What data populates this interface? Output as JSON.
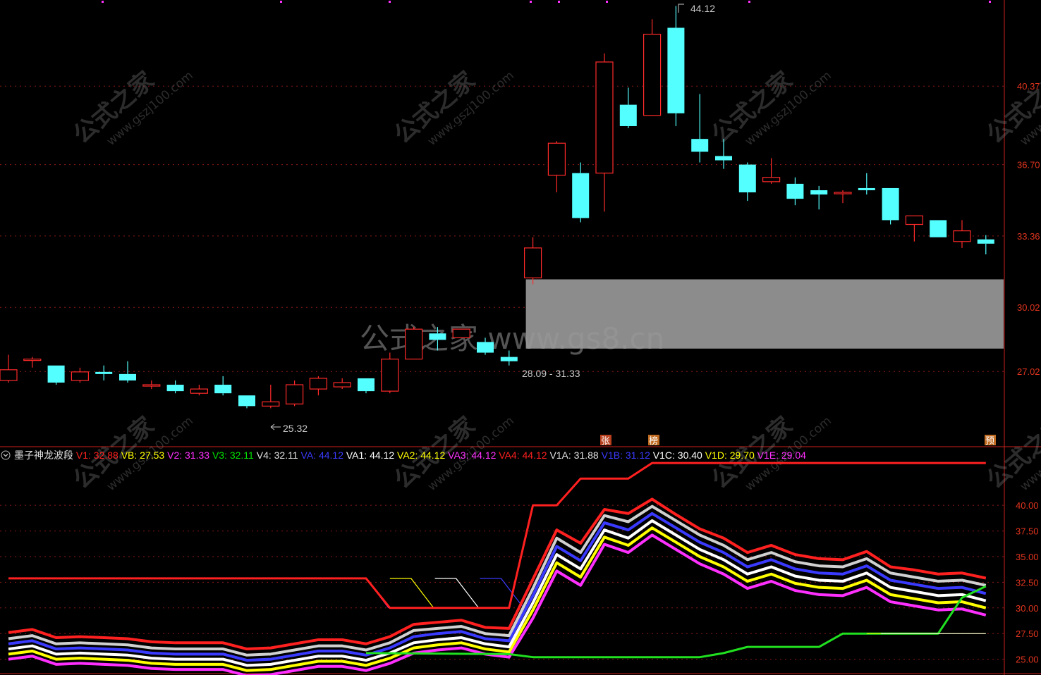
{
  "indicator": {
    "name": "墨子神龙波段",
    "collapse_icon": "chevron-down-circle-icon",
    "params": [
      {
        "key": "V1",
        "label": "V1:",
        "value": "32.88",
        "color": "#ff2020"
      },
      {
        "key": "VB",
        "label": "VB:",
        "value": "27.53",
        "color": "#ffff00"
      },
      {
        "key": "V2",
        "label": "V2:",
        "value": "31.33",
        "color": "#ff30ff"
      },
      {
        "key": "V3",
        "label": "V3:",
        "value": "32.11",
        "color": "#00e000"
      },
      {
        "key": "V4",
        "label": "V4:",
        "value": "32.11",
        "color": "#e0e0e0"
      },
      {
        "key": "VA",
        "label": "VA:",
        "value": "44.12",
        "color": "#3a3aff"
      },
      {
        "key": "VA1",
        "label": "VA1:",
        "value": "44.12",
        "color": "#ffffff"
      },
      {
        "key": "VA2",
        "label": "VA2:",
        "value": "44.12",
        "color": "#ffff00"
      },
      {
        "key": "VA3",
        "label": "VA3:",
        "value": "44.12",
        "color": "#ff30ff"
      },
      {
        "key": "VA4",
        "label": "VA4:",
        "value": "44.12",
        "color": "#ff2020"
      },
      {
        "key": "V1A",
        "label": "V1A:",
        "value": "31.88",
        "color": "#e0e0e0"
      },
      {
        "key": "V1B",
        "label": "V1B:",
        "value": "31.12",
        "color": "#3a3aff"
      },
      {
        "key": "V1C",
        "label": "V1C:",
        "value": "30.40",
        "color": "#ffffff"
      },
      {
        "key": "V1D",
        "label": "V1D:",
        "value": "29.70",
        "color": "#ffff00"
      },
      {
        "key": "V1E",
        "label": "V1E:",
        "value": "29.04",
        "color": "#ff30ff"
      }
    ]
  },
  "watermark": {
    "center": "公式之家 www.gs8.cn",
    "tile_cn": "公式之家",
    "tile_url": "www.gszj100.com"
  },
  "annotations": {
    "high_label": "44.12",
    "low_label": "25.32",
    "zone_label": "28.09 - 31.33"
  },
  "tags": [
    {
      "text": "张",
      "color": "#b8401e"
    },
    {
      "text": "榜",
      "color": "#c06a20"
    },
    {
      "text": "预",
      "color": "#c06a20"
    }
  ],
  "chart_data": [
    {
      "type": "candlestick",
      "y_axis_ticks": [
        "40.37",
        "36.70",
        "33.36",
        "30.02",
        "27.02"
      ],
      "y_tick_values": [
        40.37,
        36.7,
        33.36,
        30.02,
        27.02
      ],
      "ylim": [
        23.5,
        44.4
      ],
      "colors": {
        "up": "#ff2a2a",
        "down": "#54ffff"
      },
      "candles": [
        {
          "o": 26.6,
          "h": 27.8,
          "l": 26.5,
          "c": 27.1
        },
        {
          "o": 27.6,
          "h": 27.7,
          "l": 27.2,
          "c": 27.6
        },
        {
          "o": 27.3,
          "h": 27.3,
          "l": 26.4,
          "c": 26.5
        },
        {
          "o": 26.6,
          "h": 27.2,
          "l": 26.5,
          "c": 27.0
        },
        {
          "o": 27.0,
          "h": 27.3,
          "l": 26.6,
          "c": 26.9
        },
        {
          "o": 26.9,
          "h": 27.5,
          "l": 26.5,
          "c": 26.6
        },
        {
          "o": 26.4,
          "h": 26.6,
          "l": 26.2,
          "c": 26.4
        },
        {
          "o": 26.4,
          "h": 26.6,
          "l": 26.0,
          "c": 26.1
        },
        {
          "o": 26.0,
          "h": 26.4,
          "l": 25.9,
          "c": 26.2
        },
        {
          "o": 26.4,
          "h": 26.8,
          "l": 25.9,
          "c": 26.0
        },
        {
          "o": 25.9,
          "h": 25.9,
          "l": 25.3,
          "c": 25.4
        },
        {
          "o": 25.4,
          "h": 26.4,
          "l": 25.3,
          "c": 25.6
        },
        {
          "o": 25.5,
          "h": 26.6,
          "l": 25.4,
          "c": 26.4
        },
        {
          "o": 26.2,
          "h": 26.8,
          "l": 25.9,
          "c": 26.7
        },
        {
          "o": 26.3,
          "h": 26.7,
          "l": 26.2,
          "c": 26.5
        },
        {
          "o": 26.7,
          "h": 26.7,
          "l": 26.0,
          "c": 26.1
        },
        {
          "o": 26.1,
          "h": 27.9,
          "l": 26.0,
          "c": 27.6
        },
        {
          "o": 27.6,
          "h": 29.1,
          "l": 27.6,
          "c": 29.0
        },
        {
          "o": 28.8,
          "h": 29.1,
          "l": 28.0,
          "c": 28.5
        },
        {
          "o": 28.6,
          "h": 29.0,
          "l": 28.6,
          "c": 29.0
        },
        {
          "o": 28.4,
          "h": 28.6,
          "l": 27.8,
          "c": 27.9
        },
        {
          "o": 27.7,
          "h": 28.0,
          "l": 27.3,
          "c": 27.5
        },
        {
          "o": 31.4,
          "h": 33.3,
          "l": 31.1,
          "c": 32.8
        },
        {
          "o": 36.2,
          "h": 37.8,
          "l": 35.4,
          "c": 37.7
        },
        {
          "o": 36.3,
          "h": 36.8,
          "l": 34.0,
          "c": 34.2
        },
        {
          "o": 36.3,
          "h": 41.9,
          "l": 34.5,
          "c": 41.5
        },
        {
          "o": 39.5,
          "h": 40.3,
          "l": 38.4,
          "c": 38.5
        },
        {
          "o": 39.0,
          "h": 43.5,
          "l": 39.0,
          "c": 42.8
        },
        {
          "o": 43.1,
          "h": 44.12,
          "l": 38.5,
          "c": 39.1
        },
        {
          "o": 37.9,
          "h": 40.0,
          "l": 36.8,
          "c": 37.3
        },
        {
          "o": 37.1,
          "h": 37.9,
          "l": 36.5,
          "c": 36.9
        },
        {
          "o": 36.7,
          "h": 36.8,
          "l": 35.0,
          "c": 35.4
        },
        {
          "o": 35.9,
          "h": 37.0,
          "l": 35.8,
          "c": 36.1
        },
        {
          "o": 35.8,
          "h": 36.1,
          "l": 34.8,
          "c": 35.1
        },
        {
          "o": 35.5,
          "h": 35.7,
          "l": 34.6,
          "c": 35.3
        },
        {
          "o": 35.4,
          "h": 35.5,
          "l": 34.9,
          "c": 35.4
        },
        {
          "o": 35.6,
          "h": 36.3,
          "l": 35.3,
          "c": 35.5
        },
        {
          "o": 35.6,
          "h": 35.6,
          "l": 33.9,
          "c": 34.1
        },
        {
          "o": 33.9,
          "h": 34.3,
          "l": 33.1,
          "c": 34.3
        },
        {
          "o": 34.1,
          "h": 34.1,
          "l": 33.3,
          "c": 33.3
        },
        {
          "o": 33.1,
          "h": 34.1,
          "l": 32.8,
          "c": 33.6
        },
        {
          "o": 33.2,
          "h": 33.4,
          "l": 32.5,
          "c": 33.0
        }
      ],
      "zone": {
        "low": 28.09,
        "high": 31.33,
        "from_index": 22,
        "color": "#8c8c8c"
      }
    },
    {
      "type": "line",
      "y_axis_ticks": [
        "40.00",
        "37.50",
        "35.00",
        "32.50",
        "30.00",
        "27.50",
        "25.00"
      ],
      "y_tick_values": [
        40.0,
        37.5,
        35.0,
        32.5,
        30.0,
        27.5,
        25.0
      ],
      "ylim": [
        23.6,
        44.2
      ],
      "series": [
        {
          "name": "V1",
          "color": "#ff2020",
          "width": 4,
          "values": [
            27.6,
            27.9,
            27.1,
            27.2,
            27.1,
            27.0,
            26.7,
            26.6,
            26.6,
            26.6,
            26.0,
            26.1,
            26.5,
            26.9,
            26.9,
            26.5,
            27.2,
            28.4,
            28.6,
            28.8,
            28.1,
            28.0,
            32.8,
            37.6,
            36.3,
            39.6,
            39.2,
            40.6,
            39.1,
            37.7,
            36.8,
            35.4,
            36.1,
            35.2,
            34.8,
            34.7,
            35.5,
            34.0,
            33.7,
            33.3,
            33.4,
            32.9
          ]
        },
        {
          "name": "V4",
          "color": "#d0d0d0",
          "width": 4,
          "values": [
            27.0,
            27.3,
            26.5,
            26.6,
            26.5,
            26.4,
            26.1,
            26.0,
            26.0,
            26.0,
            25.4,
            25.5,
            25.9,
            26.3,
            26.3,
            25.9,
            26.6,
            27.8,
            28.0,
            28.2,
            27.5,
            27.3,
            31.9,
            36.8,
            35.4,
            39.0,
            38.4,
            39.9,
            38.5,
            37.1,
            36.1,
            34.7,
            35.4,
            34.5,
            34.1,
            34.0,
            34.8,
            33.4,
            33.0,
            32.6,
            32.7,
            32.2
          ]
        },
        {
          "name": "V1B",
          "color": "#3a3aff",
          "width": 4,
          "values": [
            26.5,
            26.8,
            26.0,
            26.1,
            26.0,
            25.9,
            25.6,
            25.5,
            25.5,
            25.5,
            24.9,
            25.0,
            25.4,
            25.8,
            25.8,
            25.4,
            26.1,
            27.2,
            27.5,
            27.7,
            27.0,
            26.8,
            31.2,
            36.0,
            34.6,
            38.3,
            37.6,
            39.2,
            37.8,
            36.4,
            35.4,
            34.0,
            34.7,
            33.8,
            33.4,
            33.3,
            34.1,
            32.7,
            32.3,
            31.9,
            32.0,
            31.4
          ]
        },
        {
          "name": "V1C",
          "color": "#ffffff",
          "width": 4,
          "values": [
            26.0,
            26.3,
            25.5,
            25.6,
            25.5,
            25.4,
            25.1,
            25.0,
            25.0,
            25.0,
            24.4,
            24.5,
            24.9,
            25.3,
            25.3,
            24.9,
            25.6,
            26.6,
            26.9,
            27.1,
            26.5,
            26.2,
            30.5,
            35.2,
            33.8,
            37.6,
            36.8,
            38.5,
            37.1,
            35.7,
            34.7,
            33.3,
            34.0,
            33.1,
            32.7,
            32.6,
            33.4,
            32.0,
            31.6,
            31.2,
            31.3,
            30.7
          ]
        },
        {
          "name": "V1D",
          "color": "#ffff00",
          "width": 4,
          "values": [
            25.5,
            25.8,
            25.0,
            25.1,
            25.0,
            24.9,
            24.6,
            24.5,
            24.5,
            24.5,
            23.9,
            24.0,
            24.4,
            24.8,
            24.8,
            24.4,
            25.1,
            26.1,
            26.4,
            26.6,
            26.0,
            25.7,
            29.8,
            34.4,
            33.0,
            36.9,
            36.1,
            37.8,
            36.4,
            35.0,
            34.0,
            32.6,
            33.3,
            32.4,
            32.0,
            31.9,
            32.7,
            31.3,
            30.9,
            30.5,
            30.6,
            30.0
          ]
        },
        {
          "name": "V1E",
          "color": "#ff30ff",
          "width": 4,
          "values": [
            25.0,
            25.3,
            24.5,
            24.6,
            24.5,
            24.4,
            24.1,
            24.0,
            24.0,
            24.0,
            23.4,
            23.5,
            23.9,
            24.3,
            24.3,
            23.9,
            24.6,
            25.6,
            25.9,
            26.1,
            25.5,
            25.2,
            29.0,
            33.6,
            32.2,
            36.2,
            35.4,
            37.1,
            35.7,
            34.3,
            33.3,
            31.9,
            32.6,
            31.7,
            31.3,
            31.2,
            32.0,
            30.6,
            30.2,
            29.8,
            29.9,
            29.3
          ]
        }
      ],
      "step_lines": [
        {
          "name": "VA",
          "color": "#ff2020",
          "width": 3,
          "points": [
            [
              0,
              32.88
            ],
            [
              15,
              32.88
            ],
            [
              16,
              30.0
            ],
            [
              21,
              30.0
            ],
            [
              22,
              40.0
            ],
            [
              23,
              40.0
            ],
            [
              24,
              42.6
            ],
            [
              26,
              42.6
            ],
            [
              27,
              44.12
            ],
            [
              41,
              44.12
            ]
          ]
        },
        {
          "name": "V3",
          "color": "#20e020",
          "width": 3,
          "points": [
            [
              15,
              25.6
            ],
            [
              21,
              25.5
            ],
            [
              22,
              25.2
            ],
            [
              29,
              25.2
            ],
            [
              30,
              25.6
            ],
            [
              31,
              26.2
            ],
            [
              33,
              26.2
            ],
            [
              34,
              26.2
            ],
            [
              35,
              27.5
            ],
            [
              38,
              27.5
            ],
            [
              39,
              27.5
            ],
            [
              40,
              31.0
            ],
            [
              41,
              32.11
            ]
          ]
        }
      ]
    }
  ]
}
